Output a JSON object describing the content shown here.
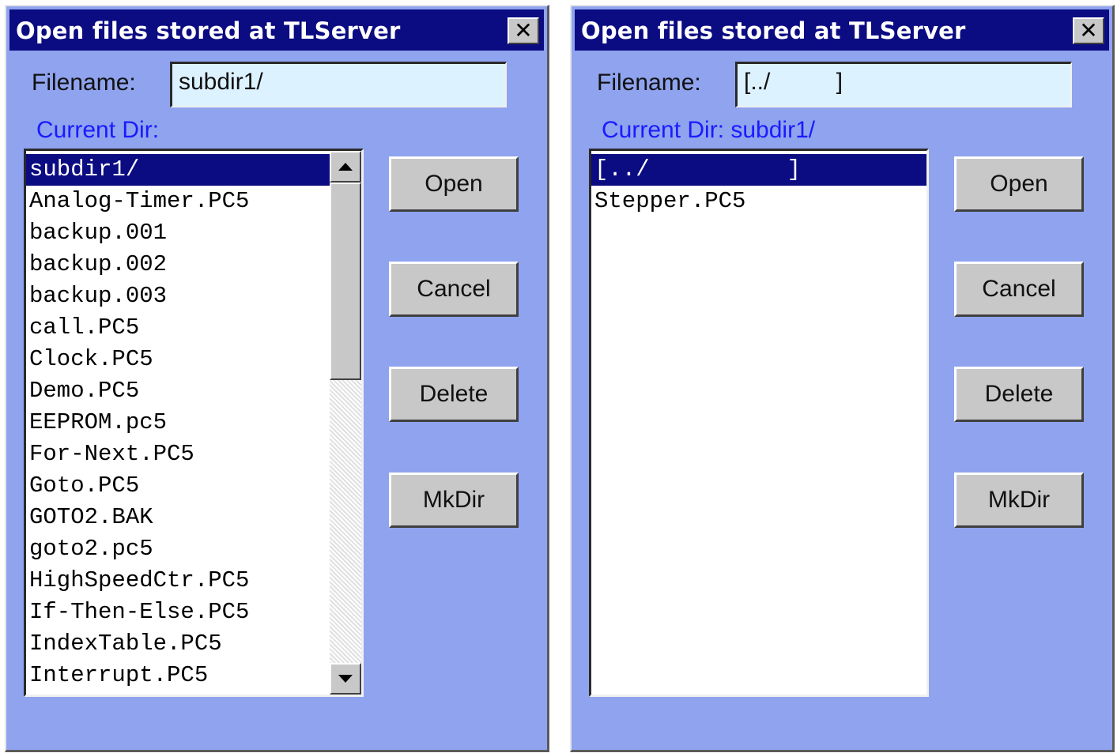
{
  "dialogs": [
    {
      "title": "Open files stored at TLServer",
      "close_label": "✕",
      "filename_label": "Filename:",
      "filename_value": "subdir1/",
      "current_dir_label": "Current Dir:",
      "files": [
        "subdir1/",
        "Analog-Timer.PC5",
        "backup.001",
        "backup.002",
        "backup.003",
        "call.PC5",
        "Clock.PC5",
        "Demo.PC5",
        "EEPROM.pc5",
        "For-Next.PC5",
        "Goto.PC5",
        "GOTO2.BAK",
        "goto2.pc5",
        "HighSpeedCtr.PC5",
        "If-Then-Else.PC5",
        "IndexTable.PC5",
        "Interrupt.PC5"
      ],
      "selected_index": 0,
      "buttons": {
        "open": "Open",
        "cancel": "Cancel",
        "delete": "Delete",
        "mkdir": "MkDir"
      }
    },
    {
      "title": "Open files stored at TLServer",
      "close_label": "✕",
      "filename_label": "Filename:",
      "filename_value": "[../          ]",
      "current_dir_label": "Current Dir: subdir1/",
      "files": [
        "[../          ]",
        "Stepper.PC5"
      ],
      "selected_index": 0,
      "buttons": {
        "open": "Open",
        "cancel": "Cancel",
        "delete": "Delete",
        "mkdir": "MkDir"
      }
    }
  ]
}
